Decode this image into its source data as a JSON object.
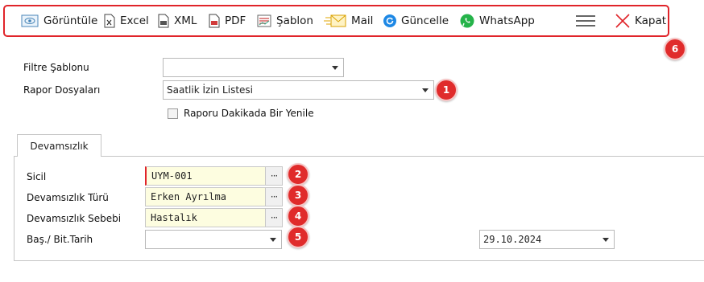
{
  "toolbar": {
    "items": [
      {
        "label": "Görüntüle",
        "icon": "view-icon"
      },
      {
        "label": "Excel",
        "icon": "excel-icon"
      },
      {
        "label": "XML",
        "icon": "xml-icon"
      },
      {
        "label": "PDF",
        "icon": "pdf-icon"
      },
      {
        "label": "Şablon",
        "icon": "template-icon"
      },
      {
        "label": "Mail",
        "icon": "mail-icon"
      },
      {
        "label": "Güncelle",
        "icon": "refresh-icon"
      },
      {
        "label": "WhatsApp",
        "icon": "whatsapp-icon"
      },
      {
        "label": "",
        "icon": "hamburger-menu-icon"
      },
      {
        "label": "Kapat",
        "icon": "close-icon"
      }
    ]
  },
  "filters": {
    "template_label": "Filtre Şablonu",
    "template_value": "",
    "report_label": "Rapor Dosyaları",
    "report_value": "Saatlik İzin Listesi",
    "refresh_checkbox_label": "Raporu Dakikada Bir Yenile",
    "refresh_checked": false
  },
  "tab": {
    "label": "Devamsızlık"
  },
  "form": {
    "sicil_label": "Sicil",
    "sicil_value": "UYM-001",
    "type_label": "Devamsızlık Türü",
    "type_value": "Erken Ayrılma",
    "reason_label": "Devamsızlık Sebebi",
    "reason_value": "Hastalık",
    "date_label": "Baş./ Bit.Tarih",
    "start_date": "",
    "end_date": "29.10.2024",
    "lookup_button": "···"
  },
  "badges": [
    "1",
    "2",
    "3",
    "4",
    "5",
    "6"
  ],
  "colors": {
    "accent_red": "#e0242a",
    "field_yellow": "#fdfde0",
    "whatsapp_green": "#25b34a",
    "refresh_blue": "#1e88e5"
  }
}
